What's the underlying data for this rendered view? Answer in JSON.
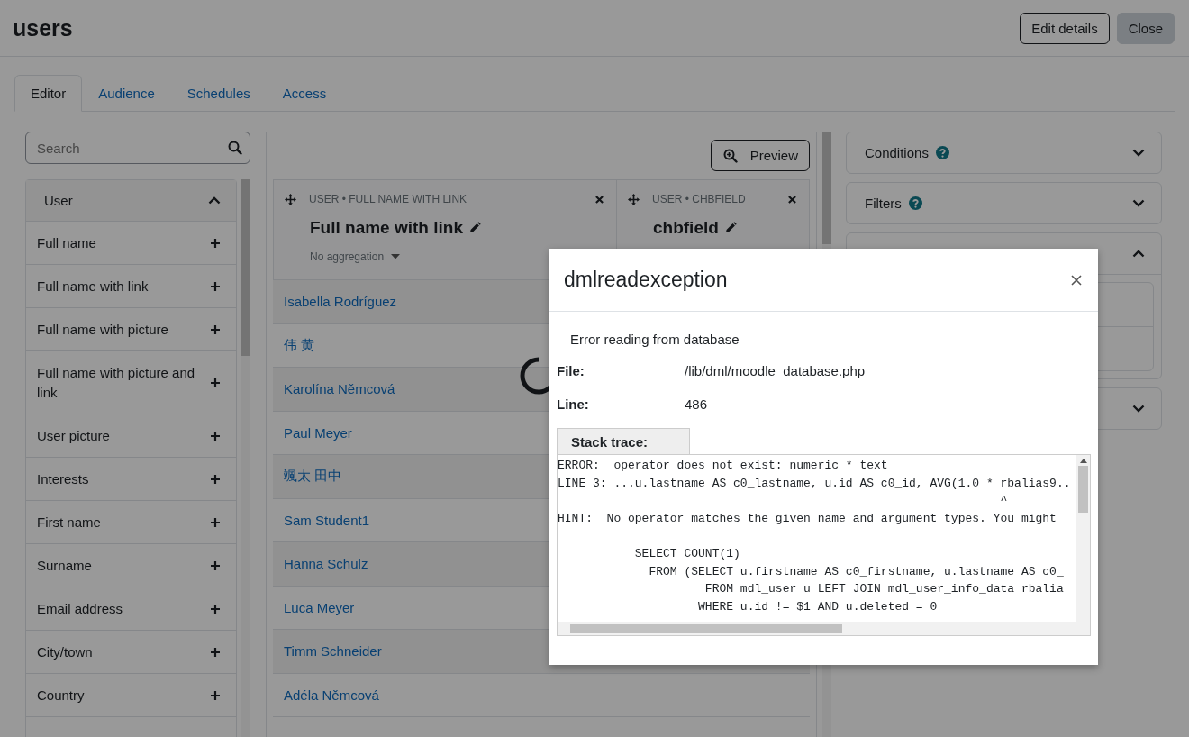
{
  "page": {
    "title": "users"
  },
  "header_buttons": [
    {
      "label": "Edit details",
      "kind": "outline"
    },
    {
      "label": "Close",
      "kind": "secondary"
    }
  ],
  "tabs": [
    {
      "label": "Editor",
      "selected": true
    },
    {
      "label": "Audience",
      "selected": false
    },
    {
      "label": "Schedules",
      "selected": false
    },
    {
      "label": "Access",
      "selected": false
    }
  ],
  "search": {
    "placeholder": "Search"
  },
  "sidebar": {
    "title": "User",
    "expanded": true,
    "items": [
      "Full name",
      "Full name with link",
      "Full name with picture",
      "Full name with picture and link",
      "User picture",
      "Interests",
      "First name",
      "Surname",
      "Email address",
      "City/town",
      "Country"
    ]
  },
  "preview_button": {
    "label": "Preview"
  },
  "columns": [
    {
      "source": "USER • FULL NAME WITH LINK",
      "heading": "Full name with link",
      "aggregation": "No aggregation"
    },
    {
      "source": "USER • CHBFIELD",
      "heading": "chbfield"
    }
  ],
  "rows": [
    "Isabella Rodríguez",
    "伟 黄",
    "Karolína Němcová",
    "Paul Meyer",
    "颯太 田中",
    "Sam Student1",
    "Hanna Schulz",
    "Luca Meyer",
    "Timm Schneider",
    "Adéla Němcová"
  ],
  "loading": true,
  "settings_cards": [
    {
      "title": "Conditions",
      "help": true,
      "expanded": false
    },
    {
      "title": "Filters",
      "help": true,
      "expanded": false
    },
    {
      "expanded": true
    },
    {
      "expanded": false
    }
  ],
  "dialog": {
    "title": "dmlreadexception",
    "message": "Error reading from database",
    "details": [
      {
        "label": "File:",
        "value": "/lib/dml/moodle_database.php"
      },
      {
        "label": "Line:",
        "value": "486"
      }
    ],
    "trace_label": "Stack trace:",
    "trace_blocks": [
      [
        "ERROR:  operator does not exist: numeric * text",
        "LINE 3: ...u.lastname AS c0_lastname, u.id AS c0_id, AVG(1.0 * rbalias9..",
        "                                                               ^",
        "HINT:  No operator matches the given name and argument types. You might"
      ],
      [
        "           SELECT COUNT(1)",
        "             FROM (SELECT u.firstname AS c0_firstname, u.lastname AS c0_",
        "                     FROM mdl_user u LEFT JOIN mdl_user_info_data rbalia",
        "                    WHERE u.id != $1 AND u.deleted = 0"
      ]
    ]
  }
}
